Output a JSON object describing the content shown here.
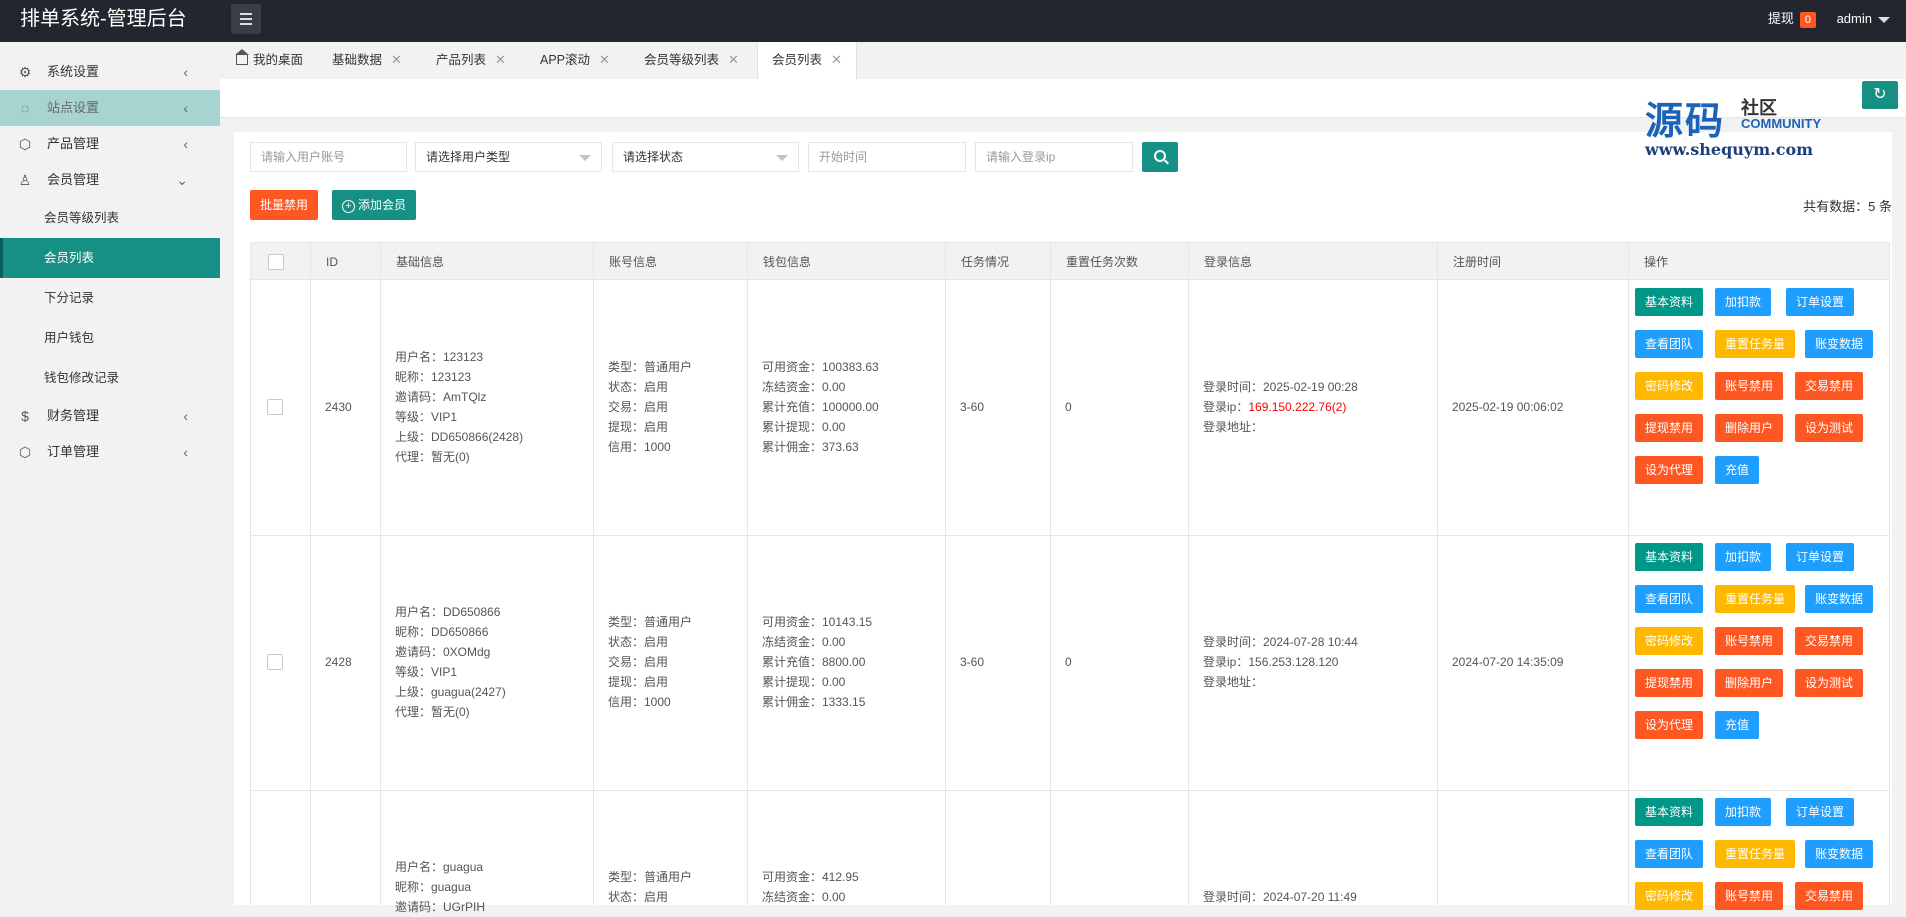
{
  "app": {
    "title": "排单系统-管理后台",
    "withdraw_label": "提现",
    "withdraw_count": "0",
    "user": "admin"
  },
  "sidebar": {
    "items": [
      {
        "label": "系统设置",
        "icon": "gear-icon"
      },
      {
        "label": "站点设置",
        "icon": "globe-icon"
      },
      {
        "label": "产品管理",
        "icon": "box-icon"
      },
      {
        "label": "会员管理",
        "icon": "user-icon"
      },
      {
        "label": "财务管理",
        "icon": "dollar-icon"
      },
      {
        "label": "订单管理",
        "icon": "cube-icon"
      }
    ],
    "children": [
      "会员等级列表",
      "会员列表",
      "下分记录",
      "用户钱包",
      "钱包修改记录"
    ]
  },
  "tabs": [
    "我的桌面",
    "基础数据",
    "产品列表",
    "APP滚动",
    "会员等级列表",
    "会员列表"
  ],
  "watermark": {
    "big": "源码",
    "small": "社区",
    "en": "COMMUNITY",
    "url": "www.shequym.com"
  },
  "search": {
    "account_placeholder": "请输入用户账号",
    "type_select": "请选择用户类型",
    "status_select": "请选择状态",
    "time_placeholder": "开始时间",
    "ip_placeholder": "请输入登录ip"
  },
  "toolbar": {
    "batch_disable": "批量禁用",
    "add_member": "添加会员",
    "total": "共有数据：5 条"
  },
  "table": {
    "headers": [
      "ID",
      "基础信息",
      "账号信息",
      "钱包信息",
      "任务情况",
      "重置任务次数",
      "登录信息",
      "注册时间",
      "操作"
    ],
    "rows": [
      {
        "id": "2430",
        "basic": [
          "用户名：123123",
          "昵称：123123",
          "邀请码：AmTQlz",
          "等级：VIP1",
          "上级：DD650866(2428)",
          "代理：暂无(0)"
        ],
        "account": [
          "类型：普通用户",
          "状态：启用",
          "交易：启用",
          "提现：启用",
          "信用：1000"
        ],
        "wallet": [
          "可用资金：100383.63",
          "冻结资金：0.00",
          "累计充值：100000.00",
          "累计提现：0.00",
          "累计佣金：373.63"
        ],
        "task": "3-60",
        "reset": "0",
        "login_time": "登录时间：2025-02-19 00:28",
        "login_ip_label": "登录ip：",
        "login_ip": "169.150.222.76(2)",
        "login_addr": "登录地址：",
        "reg_time": "2025-02-19 00:06:02"
      },
      {
        "id": "2428",
        "basic": [
          "用户名：DD650866",
          "昵称：DD650866",
          "邀请码：0XOMdg",
          "等级：VIP1",
          "上级：guagua(2427)",
          "代理：暂无(0)"
        ],
        "account": [
          "类型：普通用户",
          "状态：启用",
          "交易：启用",
          "提现：启用",
          "信用：1000"
        ],
        "wallet": [
          "可用资金：10143.15",
          "冻结资金：0.00",
          "累计充值：8800.00",
          "累计提现：0.00",
          "累计佣金：1333.15"
        ],
        "task": "3-60",
        "reset": "0",
        "login_time": "登录时间：2024-07-28 10:44",
        "login_ip_label": "登录ip：",
        "login_ip": "156.253.128.120",
        "login_addr": "登录地址：",
        "reg_time": "2024-07-20 14:35:09"
      },
      {
        "basic": [
          "用户名：guagua",
          "昵称：guagua",
          "邀请码：UGrPIH"
        ],
        "account": [
          "类型：普通用户",
          "状态：启用"
        ],
        "wallet": [
          "可用资金：412.95",
          "冻结资金：0.00"
        ],
        "login_time": "登录时间：2024-07-20 11:49"
      }
    ],
    "actions": [
      "基本资料",
      "加扣款",
      "订单设置",
      "查看团队",
      "重置任务量",
      "账变数据",
      "密码修改",
      "账号禁用",
      "交易禁用",
      "提现禁用",
      "删除用户",
      "设为测试",
      "设为代理",
      "充值"
    ],
    "action_colors": {
      "teal": "#009688",
      "blue": "#1e9fff",
      "orange": "#ffb800",
      "red": "#ff5722"
    }
  }
}
